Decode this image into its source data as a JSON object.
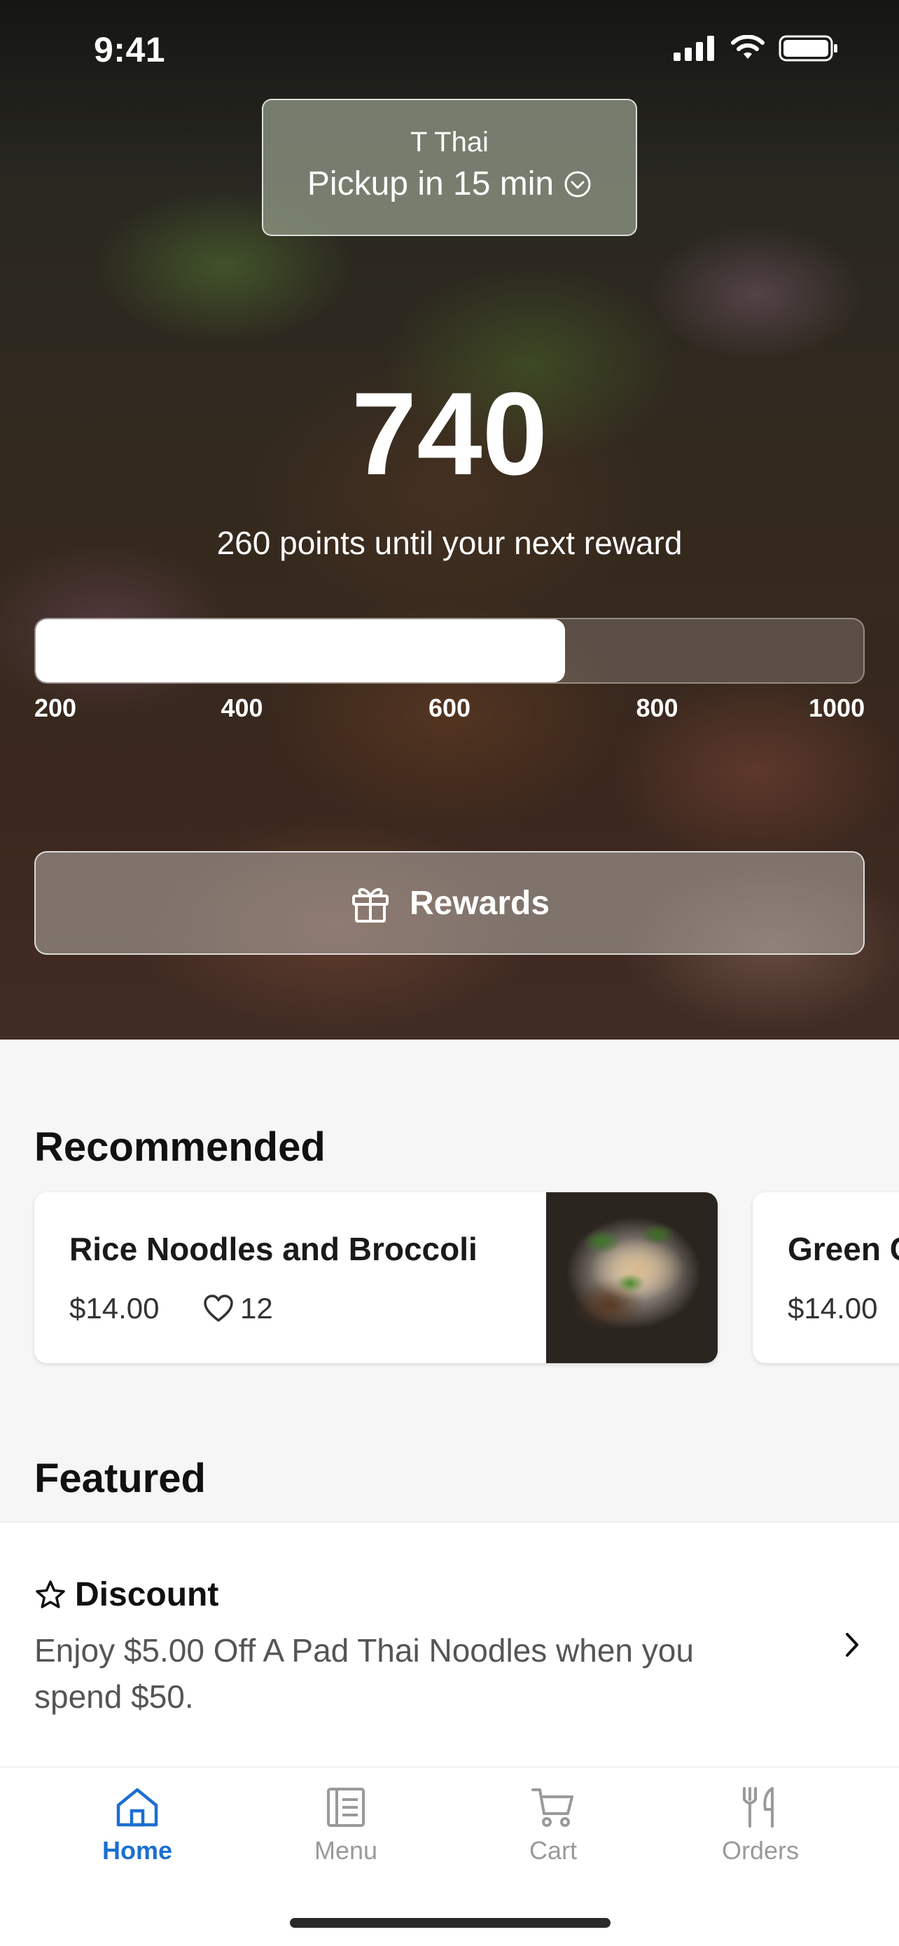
{
  "status_bar": {
    "time": "9:41"
  },
  "location": {
    "name": "T Thai",
    "pickup": "Pickup in 15 min"
  },
  "loyalty": {
    "points": "740",
    "caption": "260 points until your next reward",
    "progress_fraction": 0.64,
    "ticks": [
      "200",
      "400",
      "600",
      "800",
      "1000"
    ],
    "rewards_label": "Rewards"
  },
  "recommended": {
    "title": "Recommended",
    "items": [
      {
        "name": "Rice Noodles and Broccoli",
        "price": "$14.00",
        "likes": "12"
      },
      {
        "name": "Green C",
        "price": "$14.00"
      }
    ]
  },
  "featured": {
    "title": "Featured",
    "items": [
      {
        "title": "Discount",
        "description": "Enjoy $5.00 Off A Pad Thai Noodles when you spend $50."
      }
    ]
  },
  "tabbar": {
    "items": [
      {
        "label": "Home",
        "icon": "home-icon",
        "active": true
      },
      {
        "label": "Menu",
        "icon": "menu-icon",
        "active": false
      },
      {
        "label": "Cart",
        "icon": "cart-icon",
        "active": false
      },
      {
        "label": "Orders",
        "icon": "orders-icon",
        "active": false
      }
    ]
  },
  "colors": {
    "accent": "#1c6fd1",
    "inactive": "#9a9a9a"
  }
}
